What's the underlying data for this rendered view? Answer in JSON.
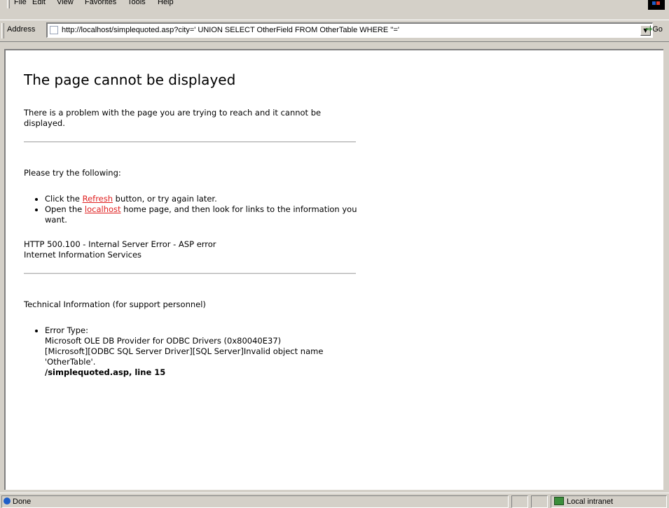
{
  "menu": [
    "File",
    "Edit",
    "View",
    "Favorites",
    "Tools",
    "Help"
  ],
  "address": {
    "label": "Address",
    "url": "http://localhost/simplequoted.asp?city=' UNION SELECT OtherField FROM OtherTable WHERE ''='",
    "go_label": "Go"
  },
  "page": {
    "title": "The page cannot be displayed",
    "intro": "There is a problem with the page you are trying to reach and it cannot be displayed.",
    "try_heading": "Please try the following:",
    "try_item1_pre": "Click the ",
    "try_item1_link": "Refresh",
    "try_item1_post": " button, or try again later.",
    "try_item2_pre": "Open the ",
    "try_item2_link": "localhost",
    "try_item2_post": " home page, and then look for links to the information you want.",
    "error_line1": "HTTP 500.100 - Internal Server Error - ASP error",
    "error_line2": "Internet Information Services",
    "tech_heading": "Technical Information (for support personnel)",
    "error_type_label": "Error Type:",
    "error_detail1": "Microsoft OLE DB Provider for ODBC Drivers (0x80040E37)",
    "error_detail2": "[Microsoft][ODBC SQL Server Driver][SQL Server]Invalid object name 'OtherTable'.",
    "error_location": "/simplequoted.asp, line 15"
  },
  "status": {
    "text": "Done",
    "zone": "Local intranet"
  },
  "colors": {
    "chrome": "#d4d0c8",
    "link": "#e02020"
  }
}
